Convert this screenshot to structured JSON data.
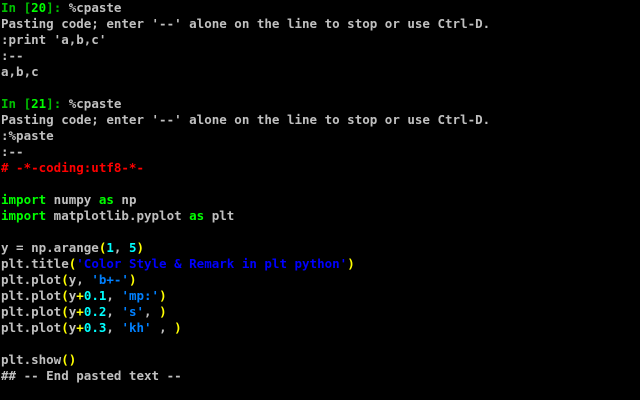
{
  "terminal": {
    "colors": {
      "default": "#c0c0c0",
      "prompt": "#00c000",
      "prompt_num": "#00ff00",
      "comment": "#ff0000",
      "keyword": "#00ff00",
      "number": "#00ffff",
      "operator": "#ffff00",
      "paren": "#ffff00",
      "string": "#0000ff",
      "string_alt": "#0080ff"
    },
    "lines": [
      [
        [
          "prompt",
          "In ["
        ],
        [
          "prompt_num",
          "20"
        ],
        [
          "prompt",
          "]: "
        ],
        [
          "default",
          "%cpaste"
        ]
      ],
      [
        [
          "default",
          "Pasting code; enter '--' alone on the line to stop or use Ctrl-D."
        ]
      ],
      [
        [
          "default",
          ":print 'a,b,c'"
        ]
      ],
      [
        [
          "default",
          ":--"
        ]
      ],
      [
        [
          "default",
          "a,b,c"
        ]
      ],
      [],
      [
        [
          "prompt",
          "In ["
        ],
        [
          "prompt_num",
          "21"
        ],
        [
          "prompt",
          "]: "
        ],
        [
          "default",
          "%cpaste"
        ]
      ],
      [
        [
          "default",
          "Pasting code; enter '--' alone on the line to stop or use Ctrl-D."
        ]
      ],
      [
        [
          "default",
          ":%paste"
        ]
      ],
      [
        [
          "default",
          ":--"
        ]
      ],
      [
        [
          "comment",
          "# -*-coding:utf8-*-"
        ]
      ],
      [],
      [
        [
          "keyword",
          "import"
        ],
        [
          "default",
          " numpy "
        ],
        [
          "keyword",
          "as"
        ],
        [
          "default",
          " np"
        ]
      ],
      [
        [
          "keyword",
          "import"
        ],
        [
          "default",
          " matplotlib.pyplot "
        ],
        [
          "keyword",
          "as"
        ],
        [
          "default",
          " plt"
        ]
      ],
      [],
      [
        [
          "default",
          "y = np.arange"
        ],
        [
          "paren",
          "("
        ],
        [
          "number",
          "1"
        ],
        [
          "default",
          ", "
        ],
        [
          "number",
          "5"
        ],
        [
          "paren",
          ")"
        ]
      ],
      [
        [
          "default",
          "plt.title"
        ],
        [
          "paren",
          "("
        ],
        [
          "string",
          "'Color Style & Remark in plt python'"
        ],
        [
          "paren",
          ")"
        ]
      ],
      [
        [
          "default",
          "plt.plot"
        ],
        [
          "paren",
          "("
        ],
        [
          "default",
          "y, "
        ],
        [
          "string_alt",
          "'b+-'"
        ],
        [
          "paren",
          ")"
        ]
      ],
      [
        [
          "default",
          "plt.plot"
        ],
        [
          "paren",
          "("
        ],
        [
          "default",
          "y"
        ],
        [
          "operator",
          "+"
        ],
        [
          "number",
          "0.1"
        ],
        [
          "default",
          ", "
        ],
        [
          "string_alt",
          "'mp:'"
        ],
        [
          "paren",
          ")"
        ]
      ],
      [
        [
          "default",
          "plt.plot"
        ],
        [
          "paren",
          "("
        ],
        [
          "default",
          "y"
        ],
        [
          "operator",
          "+"
        ],
        [
          "number",
          "0.2"
        ],
        [
          "default",
          ", "
        ],
        [
          "string_alt",
          "'s'"
        ],
        [
          "default",
          ", "
        ],
        [
          "paren",
          ")"
        ]
      ],
      [
        [
          "default",
          "plt.plot"
        ],
        [
          "paren",
          "("
        ],
        [
          "default",
          "y"
        ],
        [
          "operator",
          "+"
        ],
        [
          "number",
          "0.3"
        ],
        [
          "default",
          ", "
        ],
        [
          "string_alt",
          "'kh'"
        ],
        [
          "default",
          " , "
        ],
        [
          "paren",
          ")"
        ]
      ],
      [],
      [
        [
          "default",
          "plt.show"
        ],
        [
          "paren",
          "()"
        ]
      ],
      [
        [
          "default",
          "## -- End pasted text --"
        ]
      ]
    ]
  }
}
